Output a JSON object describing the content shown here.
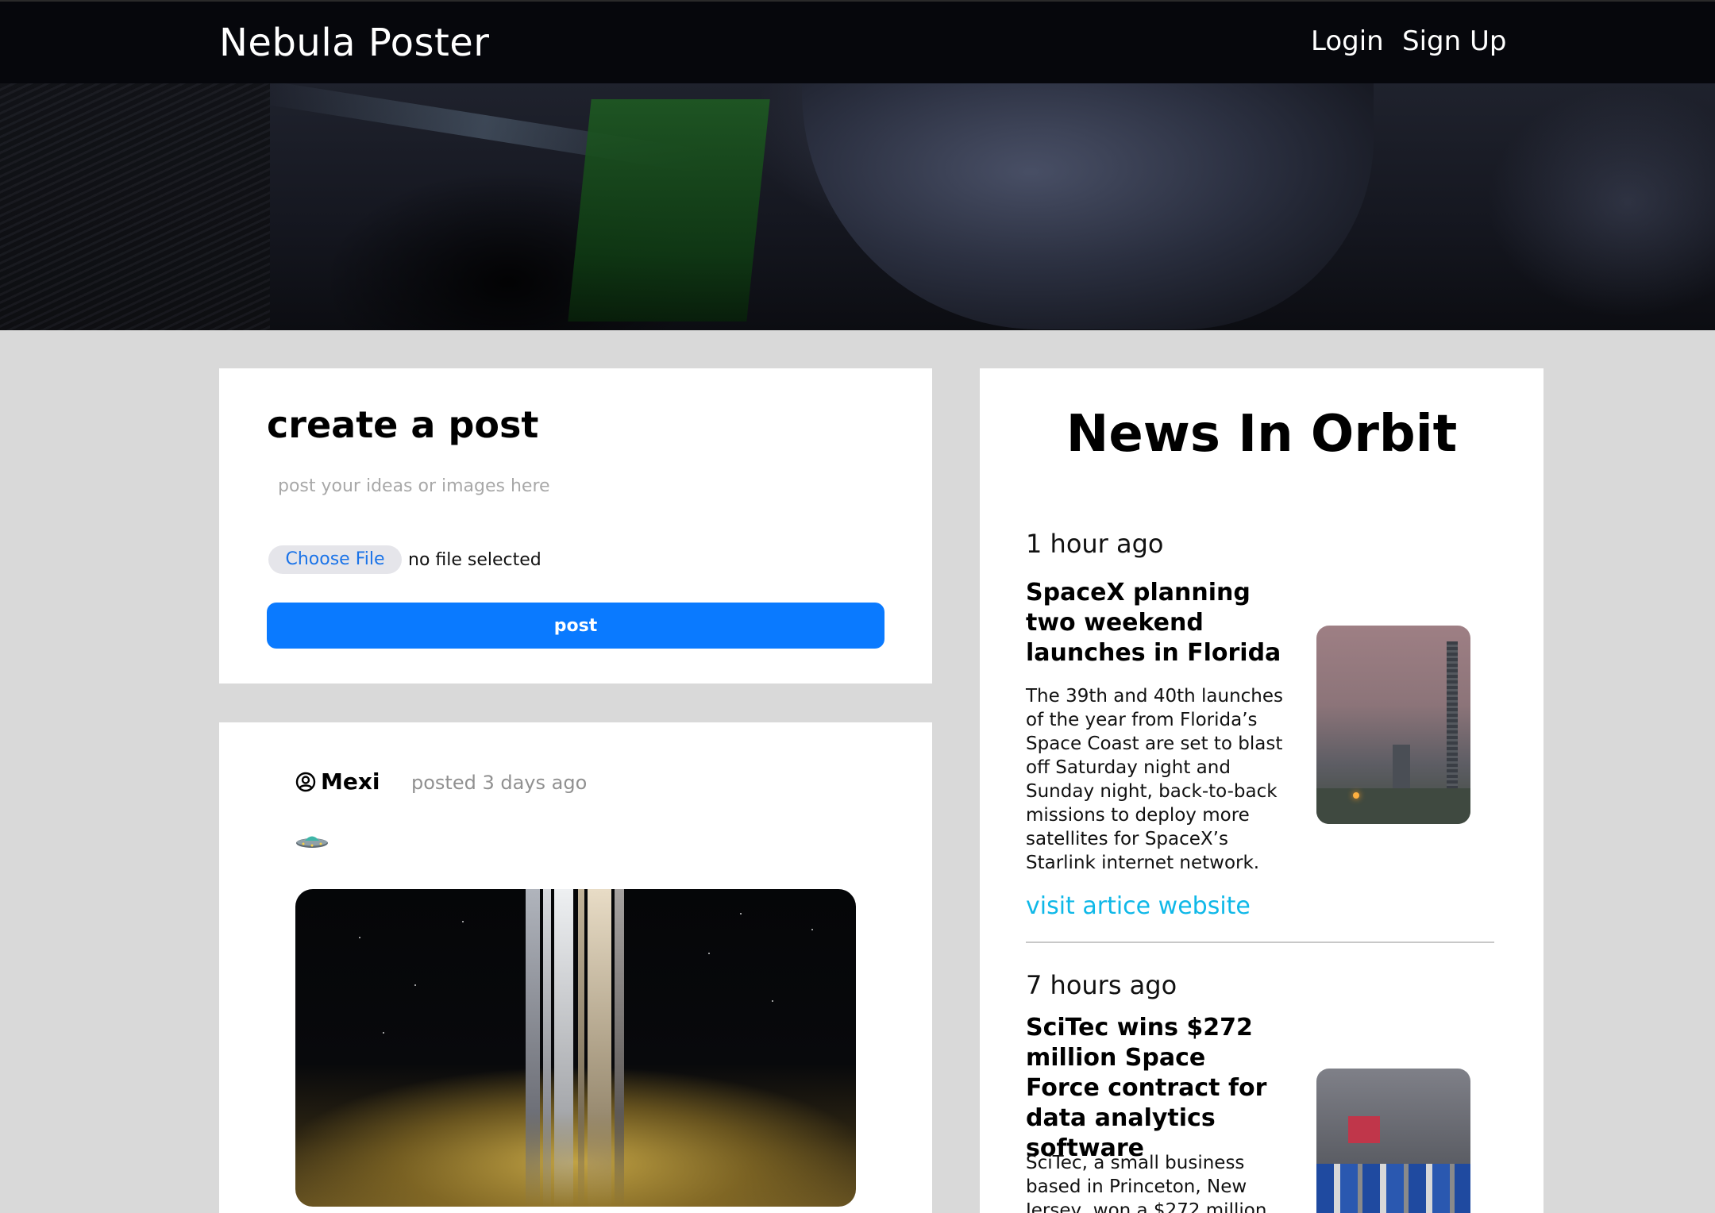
{
  "app": {
    "brand": "Nebula Poster"
  },
  "nav": {
    "login": "Login",
    "signup": "Sign Up"
  },
  "create_post": {
    "title": "create a post",
    "placeholder": "post your ideas or images here",
    "file_button": "Choose File",
    "file_status": "no file selected",
    "submit": "post"
  },
  "feed": {
    "posts": [
      {
        "author": "Mexi",
        "time": "posted 3 days ago",
        "avatar_icon": "user-circle-icon",
        "emoji_icon": "ufo-icon"
      }
    ]
  },
  "news": {
    "title": "News In Orbit",
    "items": [
      {
        "time": "1 hour ago",
        "headline": "SpaceX planning two weekend launches in Florida",
        "summary": "The 39th and 40th launches of the year from Florida’s Space Coast are set to blast off Saturday night and Sunday night, back-to-back missions to deploy more satellites for SpaceX’s Starlink internet network.",
        "link": "visit artice website"
      },
      {
        "time": "7 hours ago",
        "headline": "SciTec wins $272 million Space Force contract for data analytics software",
        "summary": "SciTec, a small business based in Princeton, New Jersey, won a $272 million"
      }
    ]
  },
  "colors": {
    "navbar": "#06070c",
    "background": "#d9d9d9",
    "primary_button": "#0a7aff",
    "link": "#0fb8e8"
  }
}
